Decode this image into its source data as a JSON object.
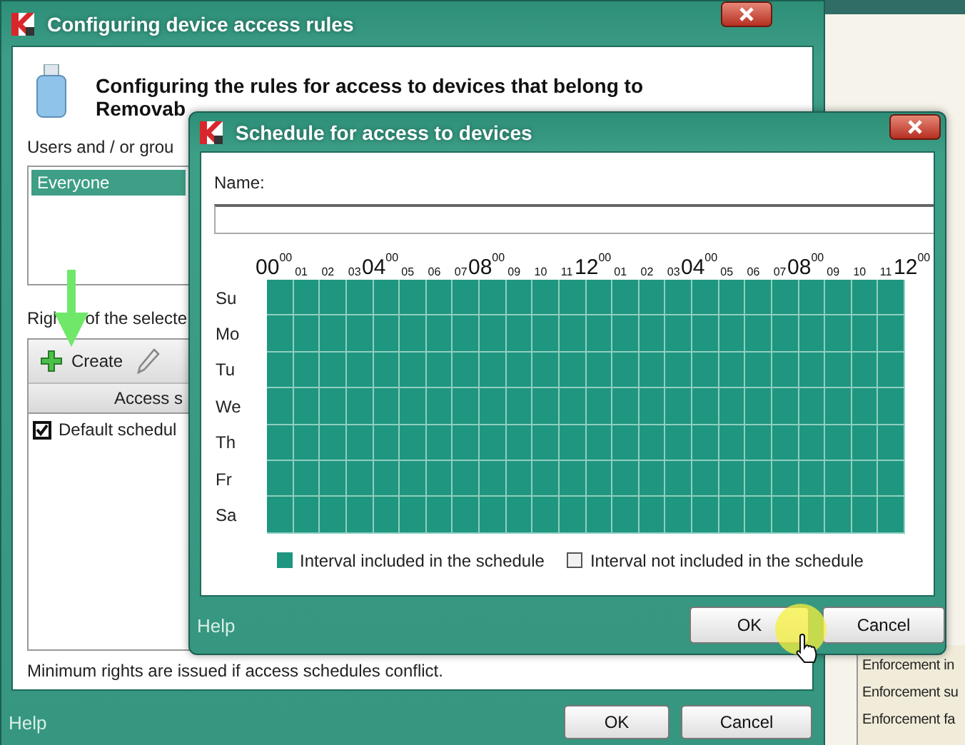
{
  "background_window": {
    "items": [
      "Enforcement in",
      "Enforcement su",
      "Enforcement fa"
    ]
  },
  "main_window": {
    "title": "Configuring device access rules",
    "heading": [
      "Configuring the rules for access to devices that belong to",
      "Removab"
    ],
    "users_label": "Users and / or grou",
    "users": [
      {
        "name": "Everyone",
        "selected": true
      }
    ],
    "rights_label": [
      "Righ",
      "of the selecte"
    ],
    "toolbar": [
      {
        "kind": "create",
        "label": "Create"
      },
      {
        "kind": "edit"
      }
    ],
    "table": {
      "columns": [
        "Access s"
      ],
      "rows": [
        {
          "name": "Default schedul",
          "checked": true
        }
      ]
    },
    "note": "Minimum rights are issued if access schedules conflict.",
    "help": "Help",
    "buttons": [
      "OK",
      "Cancel"
    ]
  },
  "schedule_dialog": {
    "title": "Schedule for access to devices",
    "name_label": "Name:",
    "hours": [
      {
        "kind": "major",
        "text": "00$^{00}$"
      },
      {
        "kind": "minor",
        "text": "01"
      },
      {
        "kind": "minor",
        "text": "02"
      },
      {
        "kind": "minor",
        "text": "03"
      },
      {
        "kind": "major",
        "text": "04$^{00}$"
      },
      {
        "kind": "minor",
        "text": "05"
      },
      {
        "kind": "minor",
        "text": "06"
      },
      {
        "kind": "minor",
        "text": "07"
      },
      {
        "kind": "major",
        "text": "08$^{00}$"
      },
      {
        "kind": "minor",
        "text": "09"
      },
      {
        "kind": "minor",
        "text": "10"
      },
      {
        "kind": "minor",
        "text": "11"
      },
      {
        "kind": "major",
        "text": "12$^{00}$"
      },
      {
        "kind": "minor",
        "text": "01"
      },
      {
        "kind": "minor",
        "text": "02"
      },
      {
        "kind": "minor",
        "text": "03"
      },
      {
        "kind": "major",
        "text": "04$^{00}$"
      },
      {
        "kind": "minor",
        "text": "05"
      },
      {
        "kind": "minor",
        "text": "06"
      },
      {
        "kind": "minor",
        "text": "07"
      },
      {
        "kind": "major",
        "text": "08$^{00}$"
      },
      {
        "kind": "minor",
        "text": "09"
      },
      {
        "kind": "minor",
        "text": "10"
      },
      {
        "kind": "minor",
        "text": "11"
      },
      {
        "kind": "major",
        "text": "12$^{00}$"
      }
    ],
    "days": [
      {
        "label": "Su",
        "included": [
          true,
          true,
          true,
          true,
          true,
          true,
          true,
          true,
          true,
          true,
          true,
          true,
          true,
          true,
          true,
          true,
          true,
          true,
          true,
          true,
          true,
          true,
          true,
          true
        ]
      },
      {
        "label": "Mo",
        "included": [
          true,
          true,
          true,
          true,
          true,
          true,
          true,
          true,
          true,
          true,
          true,
          true,
          true,
          true,
          true,
          true,
          true,
          true,
          true,
          true,
          true,
          true,
          true,
          true
        ]
      },
      {
        "label": "Tu",
        "included": [
          true,
          true,
          true,
          true,
          true,
          true,
          true,
          true,
          true,
          true,
          true,
          true,
          true,
          true,
          true,
          true,
          true,
          true,
          true,
          true,
          true,
          true,
          true,
          true
        ]
      },
      {
        "label": "We",
        "included": [
          true,
          true,
          true,
          true,
          true,
          true,
          true,
          true,
          true,
          true,
          true,
          true,
          true,
          true,
          true,
          true,
          true,
          true,
          true,
          true,
          true,
          true,
          true,
          true
        ]
      },
      {
        "label": "Th",
        "included": [
          true,
          true,
          true,
          true,
          true,
          true,
          true,
          true,
          true,
          true,
          true,
          true,
          true,
          true,
          true,
          true,
          true,
          true,
          true,
          true,
          true,
          true,
          true,
          true
        ]
      },
      {
        "label": "Fr",
        "included": [
          true,
          true,
          true,
          true,
          true,
          true,
          true,
          true,
          true,
          true,
          true,
          true,
          true,
          true,
          true,
          true,
          true,
          true,
          true,
          true,
          true,
          true,
          true,
          true
        ]
      },
      {
        "label": "Sa",
        "included": [
          true,
          true,
          true,
          true,
          true,
          true,
          true,
          true,
          true,
          true,
          true,
          true,
          true,
          true,
          true,
          true,
          true,
          true,
          true,
          true,
          true,
          true,
          true,
          true
        ]
      }
    ],
    "legend": [
      {
        "kind": "included",
        "label": "Interval included in the schedule"
      },
      {
        "kind": "excluded",
        "label": "Interval not included in the schedule"
      }
    ],
    "help": "Help",
    "buttons": [
      "OK",
      "Cancel"
    ]
  }
}
